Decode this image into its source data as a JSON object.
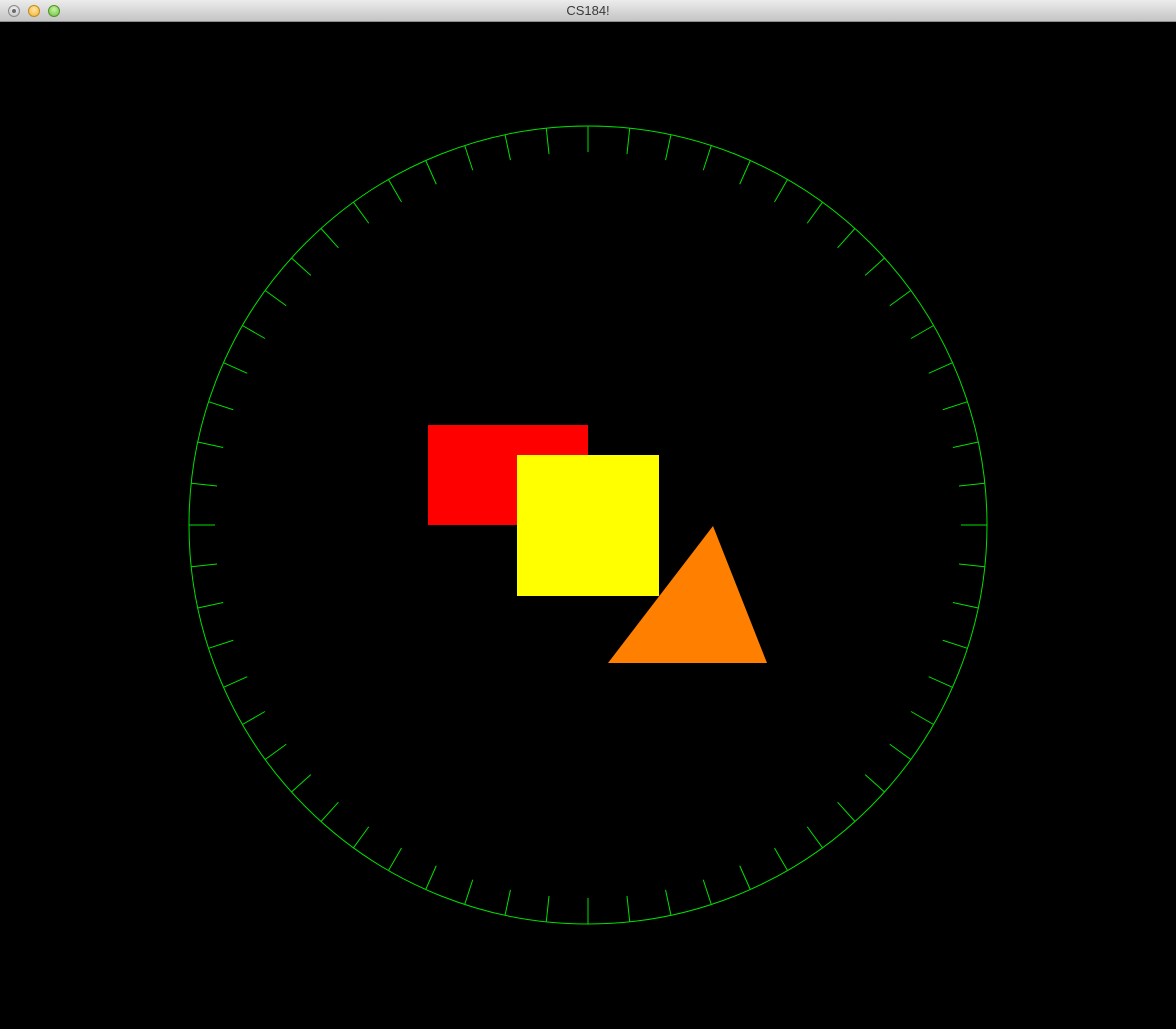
{
  "window": {
    "title": "CS184!"
  },
  "scene": {
    "background_color": "#000000",
    "dial": {
      "color": "#00e000",
      "tick_count": 60
    },
    "shapes": [
      {
        "name": "red-rectangle",
        "kind": "rect",
        "color": "#ff0000"
      },
      {
        "name": "yellow-square",
        "kind": "rect",
        "color": "#ffff00"
      },
      {
        "name": "orange-triangle",
        "kind": "triangle",
        "color": "#ff8000"
      }
    ]
  }
}
